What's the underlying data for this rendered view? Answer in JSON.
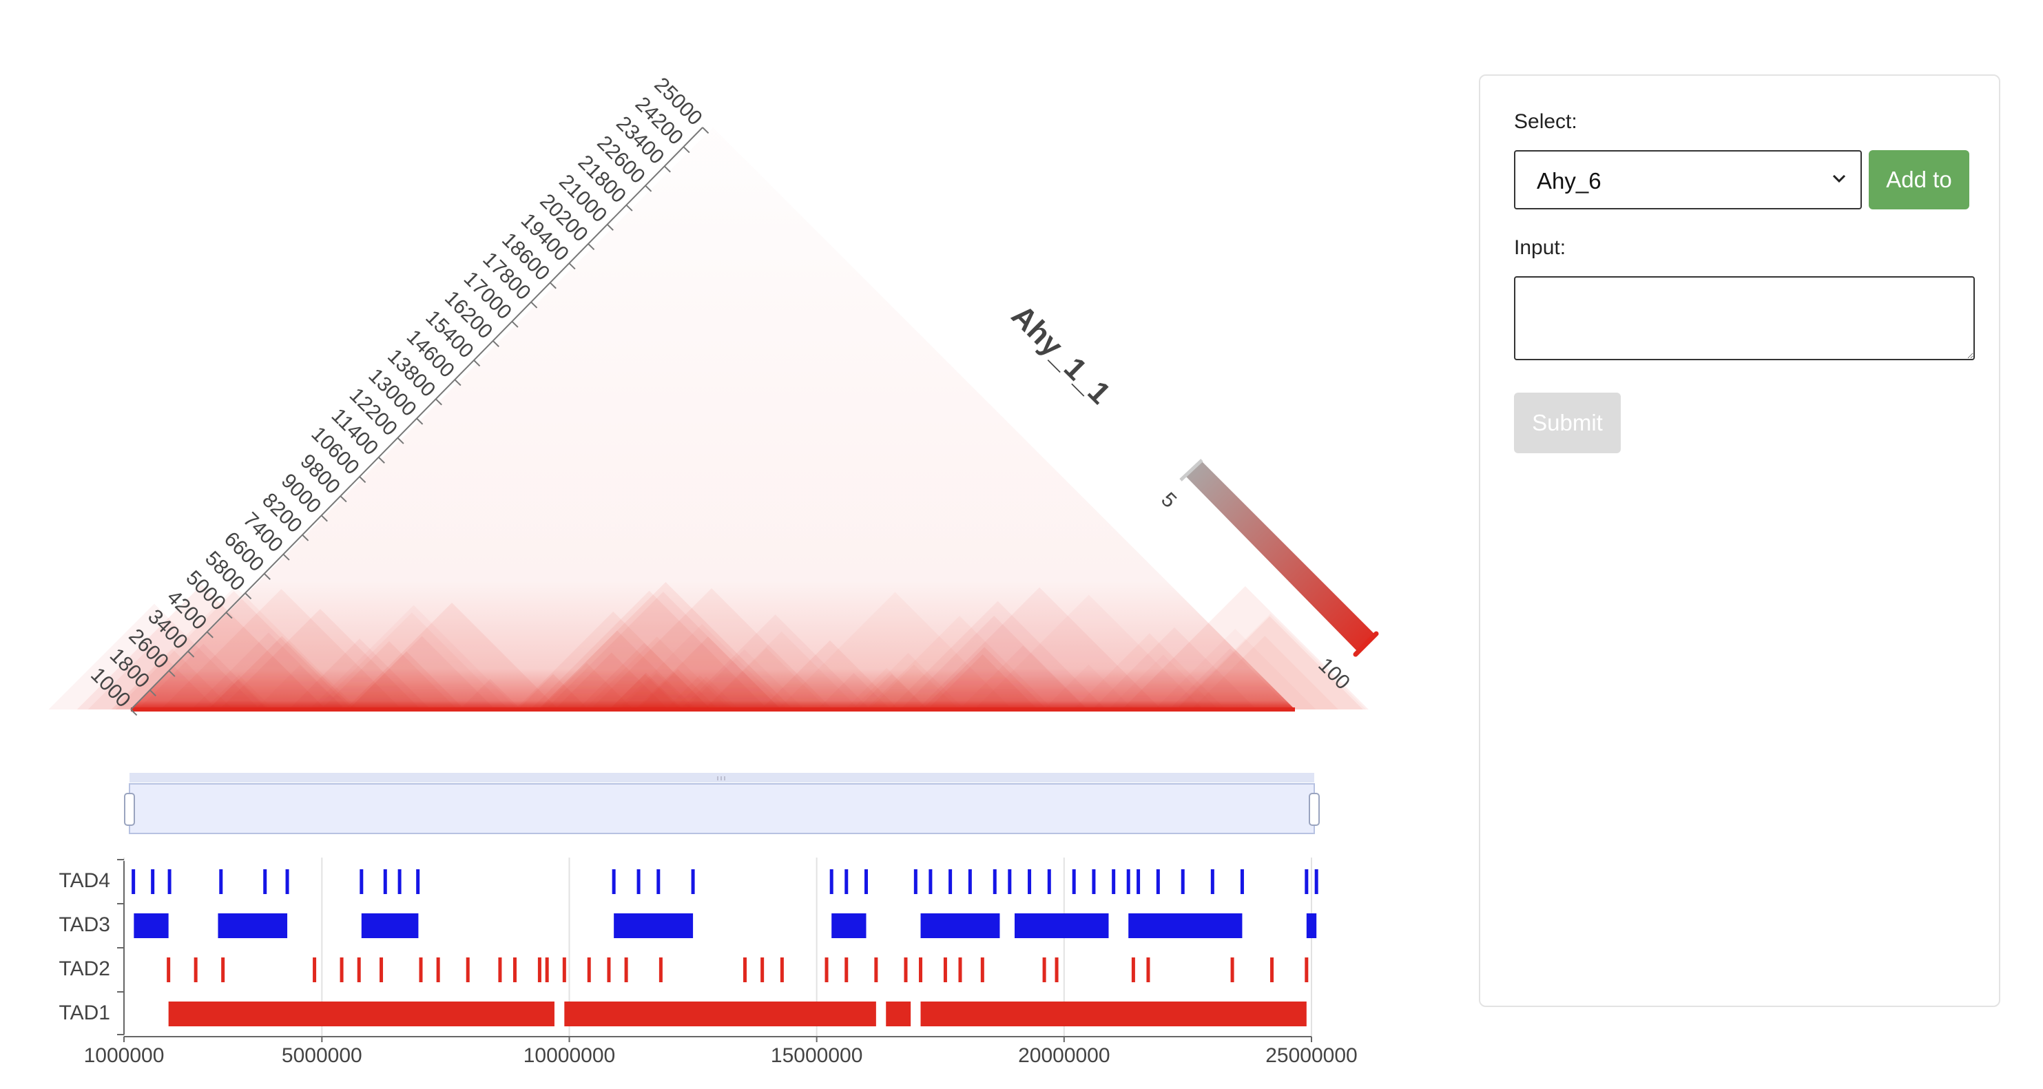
{
  "chart_data": [
    {
      "type": "heatmap",
      "title": "Ahy_1_1",
      "axis_ticks": [
        "1000",
        "1800",
        "2600",
        "3400",
        "4200",
        "5000",
        "5800",
        "6600",
        "7400",
        "8200",
        "9000",
        "9800",
        "10600",
        "11400",
        "12200",
        "13000",
        "13800",
        "14600",
        "15400",
        "16200",
        "17000",
        "17800",
        "18600",
        "19400",
        "20200",
        "21000",
        "21800",
        "22600",
        "23400",
        "24200",
        "25000"
      ],
      "color_scale": {
        "min": 5,
        "max": 100,
        "min_color": "#aaaaaa",
        "max_color": "#e0281e"
      }
    },
    {
      "type": "bar",
      "x_range": [
        1000000,
        25000000
      ],
      "x_ticks": [
        "1000000",
        "5000000",
        "10000000",
        "15000000",
        "20000000",
        "25000000"
      ],
      "tracks": [
        "TAD4",
        "TAD3",
        "TAD2",
        "TAD1"
      ],
      "series": [
        {
          "name": "TAD4",
          "color": "#1515e6",
          "marks": [
            1190000,
            1580000,
            1920000,
            2960000,
            3850000,
            4300000,
            5800000,
            6280000,
            6570000,
            6940000,
            10900000,
            11400000,
            11800000,
            12500000,
            15300000,
            15600000,
            16000000,
            17000000,
            17300000,
            17700000,
            18100000,
            18600000,
            18900000,
            19300000,
            19700000,
            20200000,
            20600000,
            21000000,
            21300000,
            21500000,
            21900000,
            22400000,
            23000000,
            23600000,
            24900000,
            25100000
          ]
        },
        {
          "name": "TAD3",
          "color": "#1515e6",
          "segments": [
            [
              1200000,
              1900000
            ],
            [
              2900000,
              4300000
            ],
            [
              5800000,
              6950000
            ],
            [
              10900000,
              12500000
            ],
            [
              15300000,
              16000000
            ],
            [
              17100000,
              18700000
            ],
            [
              19000000,
              20900000
            ],
            [
              21300000,
              23600000
            ],
            [
              24900000,
              25100000
            ]
          ]
        },
        {
          "name": "TAD2",
          "color": "#e0281e",
          "marks": [
            1900000,
            2450000,
            3000000,
            4850000,
            5400000,
            5750000,
            6200000,
            7000000,
            7350000,
            7950000,
            8600000,
            8900000,
            9400000,
            9550000,
            9900000,
            10400000,
            10800000,
            11150000,
            11850000,
            13550000,
            13900000,
            14300000,
            15200000,
            15600000,
            16200000,
            16800000,
            17100000,
            17600000,
            17900000,
            18350000,
            19600000,
            19850000,
            21400000,
            21700000,
            23400000,
            24200000,
            24900000
          ]
        },
        {
          "name": "TAD1",
          "color": "#e0281e",
          "segments": [
            [
              1900000,
              9700000
            ],
            [
              9900000,
              16200000
            ],
            [
              16400000,
              16900000
            ],
            [
              17100000,
              24900000
            ]
          ]
        }
      ]
    }
  ],
  "panel": {
    "select_label": "Select:",
    "selected_value": "Ahy_6",
    "add_button": "Add to",
    "input_label": "Input:",
    "input_value": "",
    "submit_button": "Submit"
  }
}
